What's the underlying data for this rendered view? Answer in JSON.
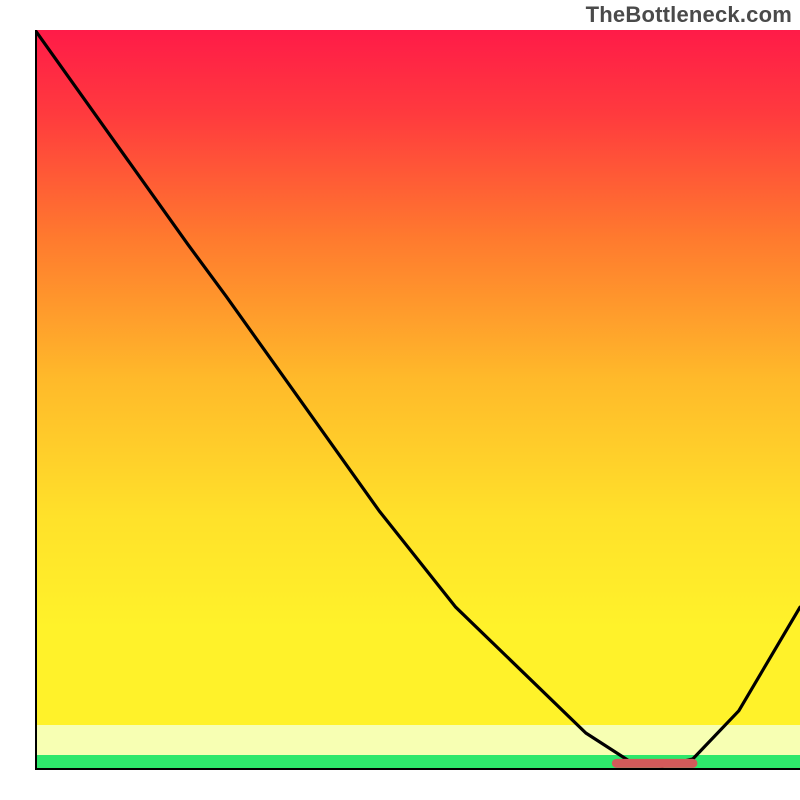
{
  "watermark": {
    "text": "TheBottleneck.com"
  },
  "chart_data": {
    "type": "line",
    "title": "",
    "xlabel": "",
    "ylabel": "",
    "xlim": [
      0,
      100
    ],
    "ylim": [
      0,
      100
    ],
    "legend": null,
    "grid": false,
    "background_gradient": {
      "top_color": "#ff1b48",
      "mid_color": "#fff22a",
      "bottom_minor_band_color": "#f7ffb3",
      "bottom_band_color": "#2ee86b"
    },
    "curve": {
      "description": "Black curve: starts high at x=0, descends with a slope change near x≈25, reaches a minimum near x≈80, then rises toward x=100.",
      "x": [
        0,
        10,
        20,
        25,
        35,
        45,
        55,
        65,
        72,
        78,
        82,
        86,
        92,
        100
      ],
      "y": [
        100,
        85.5,
        71,
        64,
        49.5,
        35,
        22,
        12,
        5,
        1,
        0.5,
        1.5,
        8,
        22
      ]
    },
    "marker": {
      "description": "Short horizontal marker near the curve minimum, just above the x-axis.",
      "x_start": 76,
      "x_end": 86,
      "y": 0.9,
      "color": "#d35a5a"
    }
  }
}
